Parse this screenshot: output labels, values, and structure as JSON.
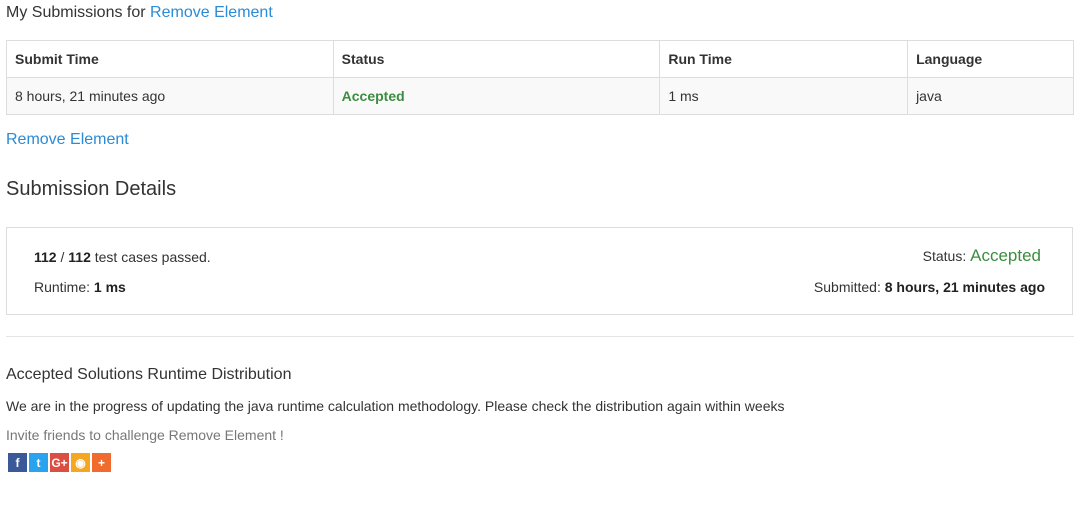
{
  "header": {
    "prefix": "My Submissions for",
    "problem_link": "Remove Element"
  },
  "table": {
    "columns": [
      "Submit Time",
      "Status",
      "Run Time",
      "Language"
    ],
    "rows": [
      {
        "submit_time": "8 hours, 21 minutes ago",
        "status": "Accepted",
        "run_time": "1 ms",
        "language": "java"
      }
    ]
  },
  "problem_link_below": "Remove Element",
  "details": {
    "title": "Submission Details",
    "passed": "112",
    "separator": "/",
    "total": "112",
    "cases_text": "test cases passed.",
    "runtime_label": "Runtime:",
    "runtime_value": "1 ms",
    "status_label": "Status:",
    "status_value": "Accepted",
    "submitted_label": "Submitted:",
    "submitted_value": "8 hours, 21 minutes ago"
  },
  "distribution": {
    "title": "Accepted Solutions Runtime Distribution",
    "note": "We are in the progress of updating the java runtime calculation methodology. Please check the distribution again within weeks"
  },
  "invite": "Invite friends to challenge Remove Element !",
  "social": [
    {
      "icon": "facebook-icon",
      "glyph": "f",
      "color": "#3b5998"
    },
    {
      "icon": "twitter-icon",
      "glyph": "t",
      "color": "#2aa3ef"
    },
    {
      "icon": "google-plus-icon",
      "glyph": "G+",
      "color": "#dc4e41"
    },
    {
      "icon": "weibo-icon",
      "glyph": "◉",
      "color": "#f5a623"
    },
    {
      "icon": "add-share-icon",
      "glyph": "+",
      "color": "#f06b2d"
    }
  ],
  "colors": {
    "link": "#2a8bd6",
    "accepted": "#3c8d40"
  }
}
